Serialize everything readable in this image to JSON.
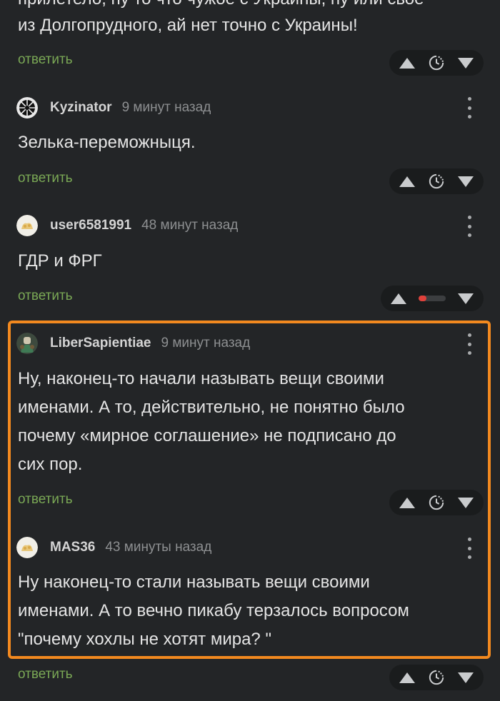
{
  "comments": [
    {
      "text_line1": "прилетело, ну то что чужое с Украины, ну или своё",
      "text_line2": "из Долгопрудного, ай нет точно с Украины!",
      "reply_label": "ответить"
    },
    {
      "author": "Kyzinator",
      "time": "9 минут назад",
      "text": "Зелька-переможныця.",
      "reply_label": "ответить"
    },
    {
      "author": "user6581991",
      "time": "48 минут назад",
      "text": "ГДР и ФРГ",
      "reply_label": "ответить",
      "rating_negative_fraction": 0.3
    },
    {
      "author": "LiberSapientiae",
      "time": "9 минут назад",
      "lines": [
        "Ну, наконец-то начали называть вещи своими",
        "именами. А то, действительно, не понятно было",
        "почему «мирное соглашение» не подписано до",
        "сих пор."
      ],
      "reply_label": "ответить"
    },
    {
      "author": "MAS36",
      "time": "43 минуты назад",
      "lines": [
        "Ну наконец-то стали называть вещи своими",
        "именами. А то вечно пикабу терзалось вопросом",
        "\"почему хохлы не хотят мира? \""
      ],
      "reply_label": "ответить"
    }
  ],
  "colors": {
    "background": "#232527",
    "reply_link": "#7aa855",
    "highlight": "#f2891f",
    "rating_negative": "#e0413b"
  },
  "icons": [
    "avatar-icon",
    "more-vertical-icon",
    "upvote-arrow-icon",
    "timer-icon",
    "downvote-arrow-icon"
  ]
}
